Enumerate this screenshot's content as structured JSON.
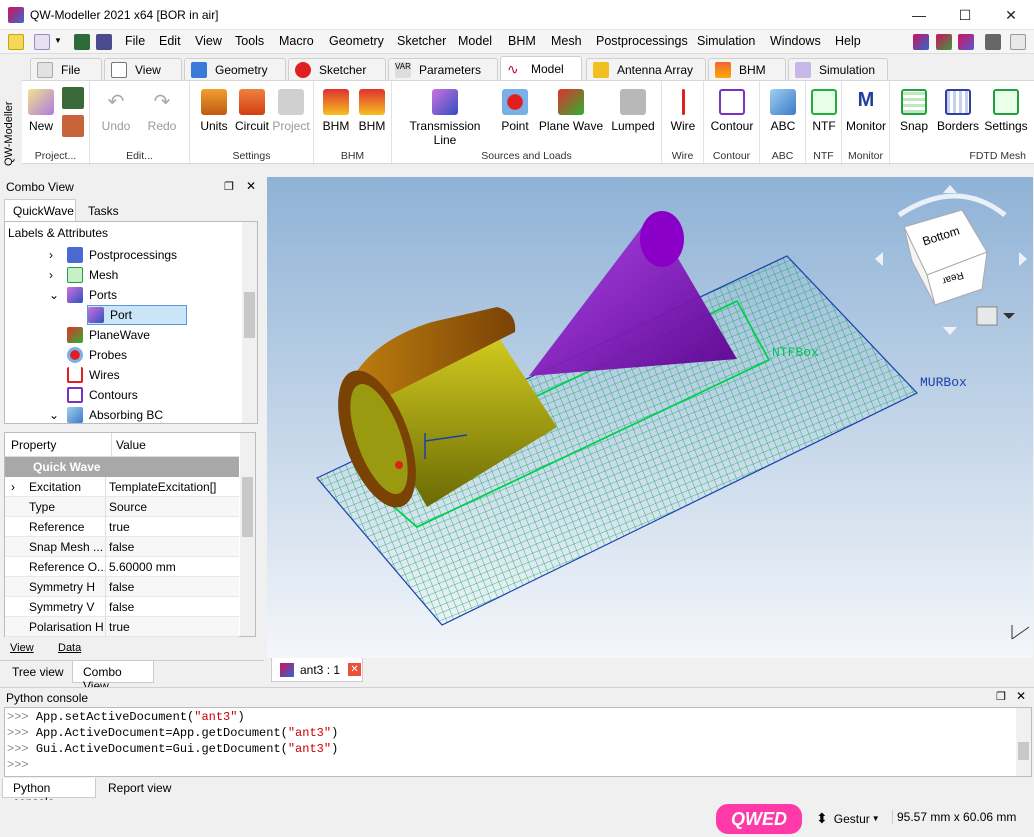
{
  "window": {
    "title": "QW-Modeller 2021 x64 [BOR in air]",
    "minimize": "—",
    "maximize": "☐",
    "close": "✕"
  },
  "menubar": {
    "items": [
      "File",
      "Edit",
      "View",
      "Tools",
      "Macro",
      "Geometry",
      "Sketcher",
      "Model",
      "BHM",
      "Mesh",
      "Postprocessings",
      "Simulation",
      "Windows",
      "Help"
    ]
  },
  "workbench_tabs": [
    "File",
    "View",
    "Geometry",
    "Sketcher",
    "Parameters",
    "Model",
    "Antenna Array",
    "BHM",
    "Simulation"
  ],
  "active_workbench": "Model",
  "side_label": "QW-Modeller",
  "ribbon": {
    "groups": [
      {
        "label": "Project...",
        "buttons": [
          "New"
        ]
      },
      {
        "label": "Edit...",
        "buttons": [
          "Undo",
          "Redo"
        ]
      },
      {
        "label": "Settings",
        "buttons": [
          "Units",
          "Circuit",
          "Project"
        ]
      },
      {
        "label": "BHM",
        "buttons": [
          "BHM",
          "BHM"
        ]
      },
      {
        "label": "Sources and Loads",
        "buttons": [
          "Transmission Line",
          "Point",
          "Plane Wave",
          "Lumped"
        ]
      },
      {
        "label": "Wire",
        "buttons": [
          "Wire"
        ]
      },
      {
        "label": "Contour",
        "buttons": [
          "Contour"
        ]
      },
      {
        "label": "ABC",
        "buttons": [
          "ABC"
        ]
      },
      {
        "label": "NTF",
        "buttons": [
          "NTF"
        ]
      },
      {
        "label": "Monitor",
        "buttons": [
          "Monitor"
        ]
      },
      {
        "label": "FDTD Mesh",
        "buttons": [
          "Snap",
          "Borders",
          "Settings"
        ]
      }
    ]
  },
  "combo_view": {
    "title": "Combo View",
    "tabs": [
      "QuickWave",
      "Tasks"
    ],
    "tree_header": "Labels & Attributes",
    "tree_items": [
      "Postprocessings",
      "Mesh",
      "Ports",
      "Port",
      "PlaneWave",
      "Probes",
      "Wires",
      "Contours",
      "Absorbing BC"
    ],
    "property_header": [
      "Property",
      "Value"
    ],
    "property_group": "Quick Wave",
    "properties": [
      {
        "key": "Excitation",
        "value": "TemplateExcitation[]"
      },
      {
        "key": "Type",
        "value": "Source"
      },
      {
        "key": "Reference",
        "value": "true"
      },
      {
        "key": "Snap Mesh ...",
        "value": "false"
      },
      {
        "key": "Reference O...",
        "value": "5.60000 mm"
      },
      {
        "key": "Symmetry H",
        "value": "false"
      },
      {
        "key": "Symmetry V",
        "value": "false"
      },
      {
        "key": "Polarisation H",
        "value": "true"
      }
    ],
    "bottom_tabs": [
      "View",
      "Data"
    ],
    "view_tabs": [
      "Tree view",
      "Combo View"
    ]
  },
  "viewport": {
    "labels": {
      "ntf": "NTFBox",
      "mur": "MURBox"
    },
    "navcube_faces": {
      "front": "Bottom",
      "side": "Rear"
    }
  },
  "doc_tab": {
    "label": "ant3 : 1"
  },
  "python_console": {
    "title": "Python console",
    "lines": [
      {
        "prefix": ">>> ",
        "code": "App.setActiveDocument(",
        "arg": "\"ant3\"",
        "tail": ")"
      },
      {
        "prefix": ">>> ",
        "code": "App.ActiveDocument=App.getDocument(",
        "arg": "\"ant3\"",
        "tail": ")"
      },
      {
        "prefix": ">>> ",
        "code": "Gui.ActiveDocument=Gui.getDocument(",
        "arg": "\"ant3\"",
        "tail": ")"
      },
      {
        "prefix": ">>> ",
        "code": "",
        "arg": "",
        "tail": ""
      }
    ],
    "tabs": [
      "Python console",
      "Report view"
    ]
  },
  "status": {
    "logo": "QWED",
    "nav_style": "Gestur",
    "dimensions": "95.57 mm x 60.06 mm"
  },
  "colors": {
    "accent_green": "#00c853",
    "cone_purple": "#8a00c8",
    "cylinder_olive": "#9a9a10",
    "mur_blue": "#1a3fb0"
  }
}
